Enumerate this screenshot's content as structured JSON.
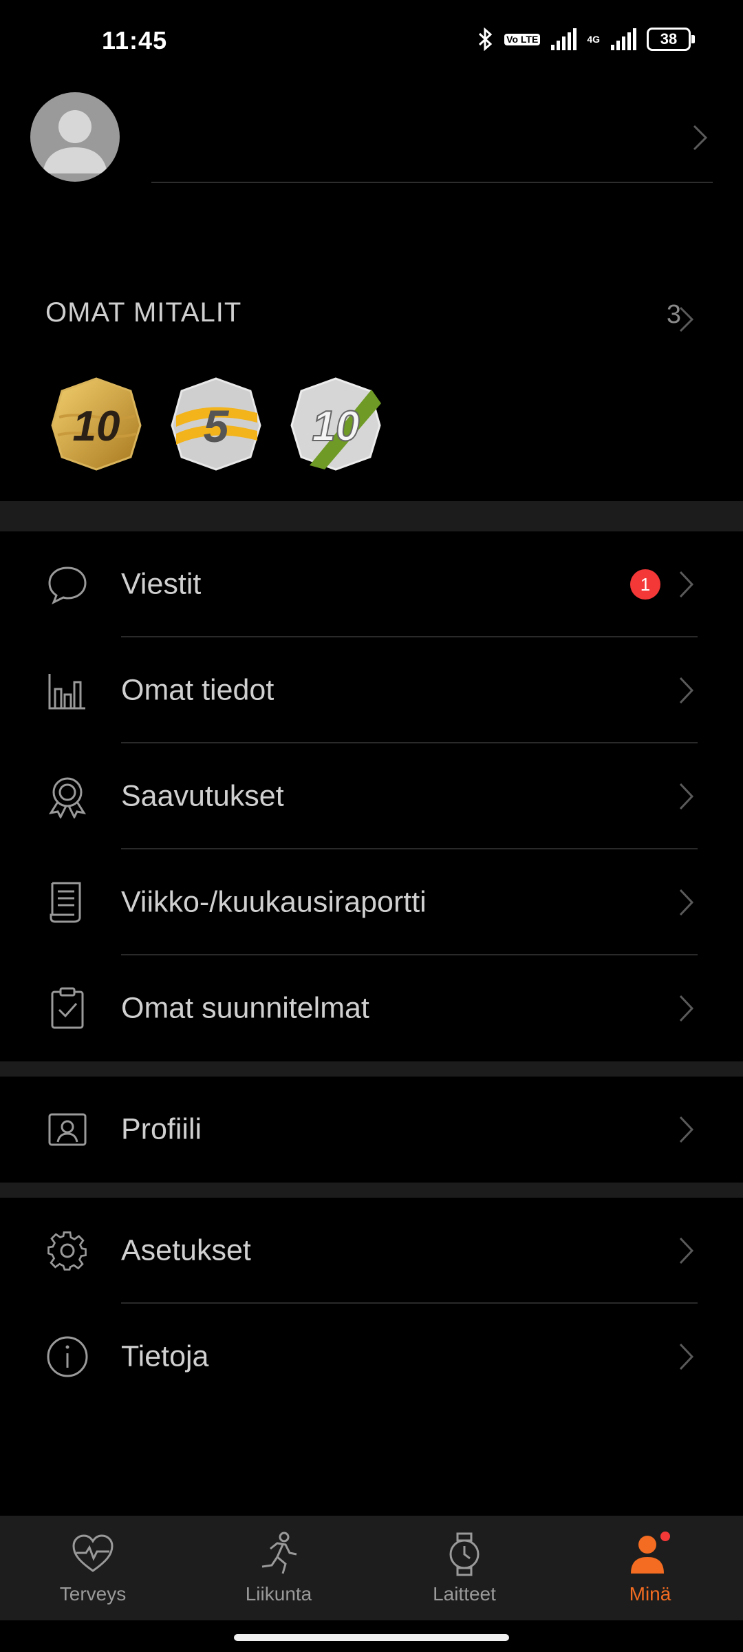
{
  "status_bar": {
    "time": "11:45",
    "network_label": "4G",
    "volte_label": "Vo LTE",
    "battery_level": "38",
    "icons": [
      "bluetooth-icon",
      "volte-icon",
      "signal-icon",
      "signal-icon"
    ]
  },
  "profile": {
    "avatar_icon": "default-avatar-icon"
  },
  "medals": {
    "title": "OMAT MITALIT",
    "count": "3",
    "items": [
      {
        "number": "10",
        "style": "gold"
      },
      {
        "number": "5",
        "style": "silver-yellow"
      },
      {
        "number": "10",
        "style": "silver-green"
      }
    ]
  },
  "menu": {
    "group1": [
      {
        "label": "Viestit",
        "icon": "message-bubble-icon",
        "badge": "1"
      },
      {
        "label": "Omat tiedot",
        "icon": "bar-chart-icon"
      },
      {
        "label": "Saavutukset",
        "icon": "award-ribbon-icon"
      },
      {
        "label": "Viikko-/kuukausiraportti",
        "icon": "report-document-icon"
      },
      {
        "label": "Omat suunnitelmat",
        "icon": "clipboard-check-icon"
      }
    ],
    "group2": [
      {
        "label": "Profiili",
        "icon": "profile-card-icon"
      }
    ],
    "group3": [
      {
        "label": "Asetukset",
        "icon": "gear-icon"
      },
      {
        "label": "Tietoja",
        "icon": "info-icon"
      }
    ]
  },
  "bottom_nav": {
    "items": [
      {
        "label": "Terveys",
        "icon": "heart-pulse-icon"
      },
      {
        "label": "Liikunta",
        "icon": "running-person-icon"
      },
      {
        "label": "Laitteet",
        "icon": "watch-icon"
      },
      {
        "label": "Minä",
        "icon": "person-icon",
        "active": true
      }
    ]
  },
  "colors": {
    "accent": "#f36c21",
    "badge": "#f43838",
    "background": "#000000",
    "nav_background": "#1d1d1d"
  }
}
